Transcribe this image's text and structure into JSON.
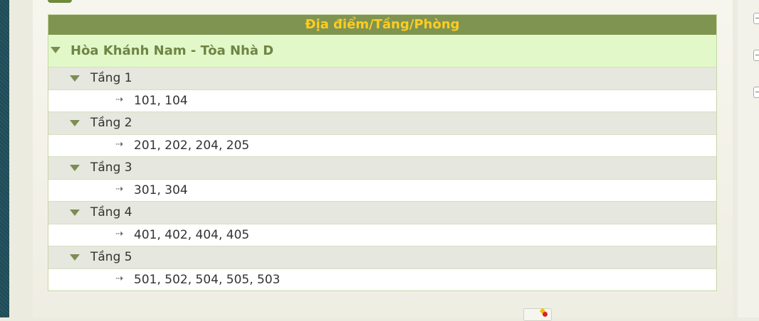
{
  "tree": {
    "header": "Địa điểm/Tầng/Phòng",
    "site": "Hòa Khánh Nam - Tòa Nhà D",
    "room_arrow": "⇢",
    "floors": [
      {
        "label": "Tầng 1",
        "rooms": "101, 104"
      },
      {
        "label": "Tầng 2",
        "rooms": "201, 202, 204, 205"
      },
      {
        "label": "Tầng 3",
        "rooms": "301, 304"
      },
      {
        "label": "Tầng 4",
        "rooms": "401, 402, 404, 405"
      },
      {
        "label": "Tầng 5",
        "rooms": "501, 502, 504, 505, 503"
      }
    ]
  },
  "icons": {
    "expand": "triangle-down-icon",
    "room": "dashed-arrow-right-icon",
    "side_toggle": "collapse-minus-icon",
    "bottom": "tools-icon"
  },
  "colors": {
    "header_bg": "#7f9450",
    "header_text": "#ffcc22",
    "site_bg": "#e2f8c8",
    "site_text": "#6f8445",
    "floor_bg": "#e6e7de",
    "room_bg": "#ffffff"
  }
}
